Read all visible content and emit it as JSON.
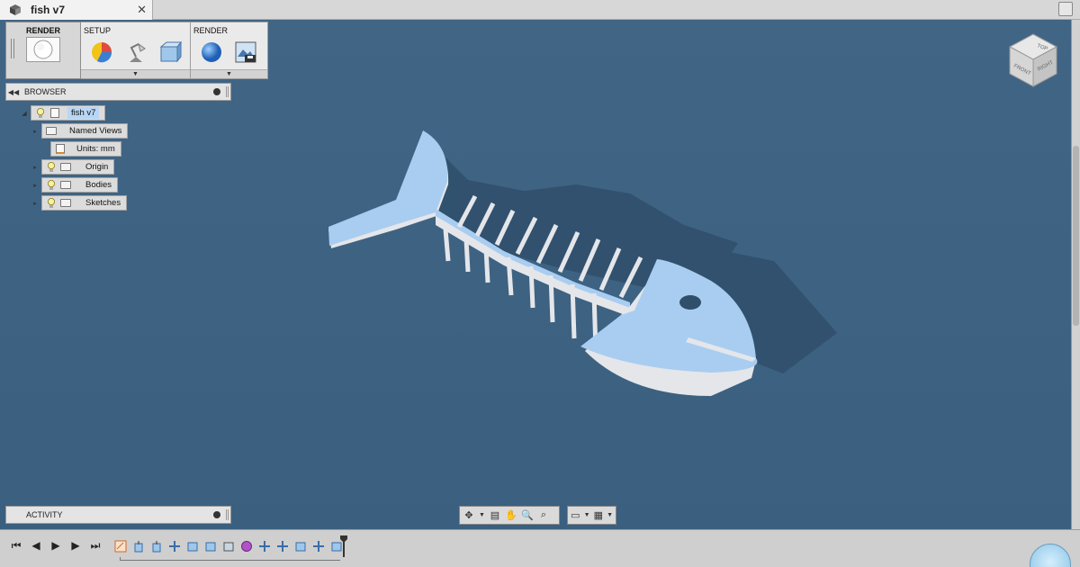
{
  "document": {
    "title": "fish v7",
    "close_glyph": "✕"
  },
  "toolbar": {
    "workspace_label": "RENDER",
    "groups": [
      {
        "label": "SETUP",
        "icons": [
          "appearance-icon",
          "scene-settings-icon",
          "environment-icon"
        ]
      },
      {
        "label": "RENDER",
        "icons": [
          "render-sphere-icon",
          "save-image-icon"
        ]
      }
    ]
  },
  "browser": {
    "header": "BROWSER",
    "tree": [
      {
        "label": "fish v7",
        "level": 0,
        "selected": true
      },
      {
        "label": "Named Views",
        "level": 1
      },
      {
        "label": "Units: mm",
        "level": 2
      },
      {
        "label": "Origin",
        "level": 1
      },
      {
        "label": "Bodies",
        "level": 1
      },
      {
        "label": "Sketches",
        "level": 1
      }
    ]
  },
  "activity": {
    "header": "ACTIVITY"
  },
  "viewcube": {
    "faces": [
      "TOP",
      "FRONT",
      "RIGHT"
    ]
  },
  "navbar": {
    "left_tools": [
      "orbit-icon",
      "look-at-icon",
      "pan-icon",
      "zoom-icon",
      "zoom-window-icon"
    ],
    "right_tools": [
      "display-settings-icon",
      "grid-settings-icon"
    ]
  },
  "timeline": {
    "controls": [
      "go-to-start",
      "step-back",
      "play",
      "step-forward",
      "go-to-end"
    ],
    "features": [
      "sketch",
      "extrude",
      "extrude",
      "move",
      "body",
      "body",
      "body",
      "component",
      "move",
      "move",
      "body",
      "move",
      "body"
    ]
  },
  "colors": {
    "viewport_bg": "#3e6283",
    "model_top": "#a9cdf0",
    "model_side": "#e6e8ec",
    "shadow": "#2c4962",
    "selection": "#b8d6f5"
  }
}
